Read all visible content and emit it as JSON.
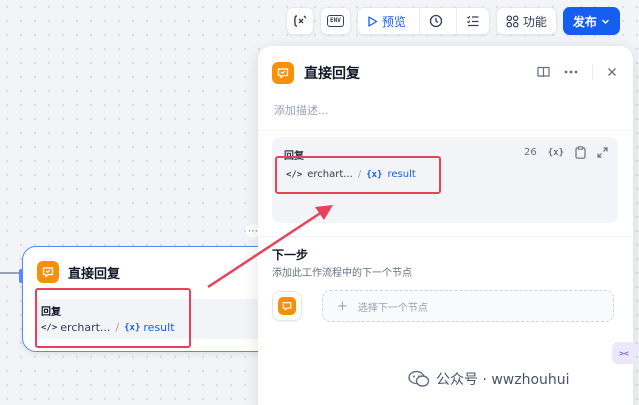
{
  "toolbar": {
    "env_label": "ENV",
    "preview_label": "预览",
    "features_label": "功能",
    "publish_label": "发布"
  },
  "canvas_node": {
    "title": "直接回复",
    "body_label": "回复",
    "variable": {
      "source": "erchart...",
      "separator": "/",
      "brace": "{x}",
      "name": "result"
    }
  },
  "panel": {
    "title": "直接回复",
    "description_placeholder": "添加描述...",
    "reply_section": {
      "label": "回复",
      "char_count": "26",
      "var_tool_label": "{x}",
      "variable": {
        "source": "erchart...",
        "separator": "/",
        "brace": "{x}",
        "name": "result"
      }
    },
    "next_step": {
      "title": "下一步",
      "description": "添加此工作流程中的下一个节点",
      "select_label": "选择下一个节点"
    }
  },
  "watermark": {
    "text": "公众号 · wwzhouhui"
  },
  "mini_badge": "><",
  "colors": {
    "accent": "#155eef",
    "node_orange": "#f79009",
    "highlight": "#e8425b"
  }
}
